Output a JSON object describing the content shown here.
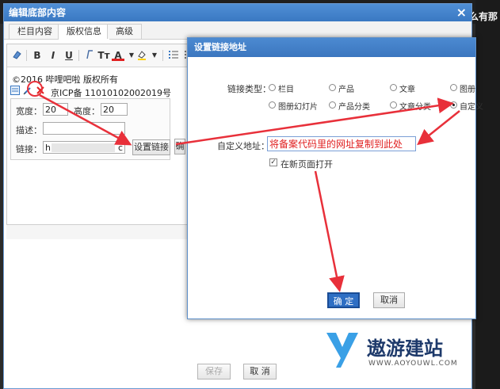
{
  "background": {
    "corner_text": "么有那"
  },
  "back_dialog": {
    "title": "编辑底部内容",
    "close": "×",
    "tabs": [
      "栏目内容",
      "版权信息",
      "高级"
    ],
    "active_tab": 1,
    "toolbar": {
      "bold": "B",
      "italic": "I",
      "underline": "U",
      "font": "Tᴛ",
      "color": "A"
    },
    "content": {
      "line1": "©2016  哔哩吧啦  版权所有",
      "line2": "京ICP备  11010102002019号"
    },
    "image_props": {
      "width_label": "宽度：",
      "width_value": "20",
      "height_label": "高度：",
      "height_value": "20",
      "desc_label": "描述：",
      "desc_value": "",
      "link_label": "链接：",
      "link_value": "h",
      "link_value_tail": "c",
      "set_link_button": "设置链接",
      "more_button": "确"
    },
    "footer": {
      "save": "保存",
      "cancel": "取 消"
    }
  },
  "link_dialog": {
    "title": "设置链接地址",
    "type_label": "链接类型：",
    "options_row1": [
      "栏目",
      "产品",
      "文章",
      "图册"
    ],
    "options_row2": [
      "图册幻灯片",
      "产品分类",
      "文章分类",
      "自定义"
    ],
    "selected": "自定义",
    "url_label": "自定义地址：",
    "url_value": "将备案代码里的网址复制到此处",
    "new_window_label": "在新页面打开",
    "new_window_checked": true,
    "ok": "确 定",
    "cancel": "取消"
  },
  "watermark": {
    "brand": "遨游建站",
    "url": "WWW.AOYOUWL.COM"
  },
  "colors": {
    "title_bar": "#3a78c2",
    "annotation": "#e8303a",
    "ok_button": "#2f6fc4"
  }
}
